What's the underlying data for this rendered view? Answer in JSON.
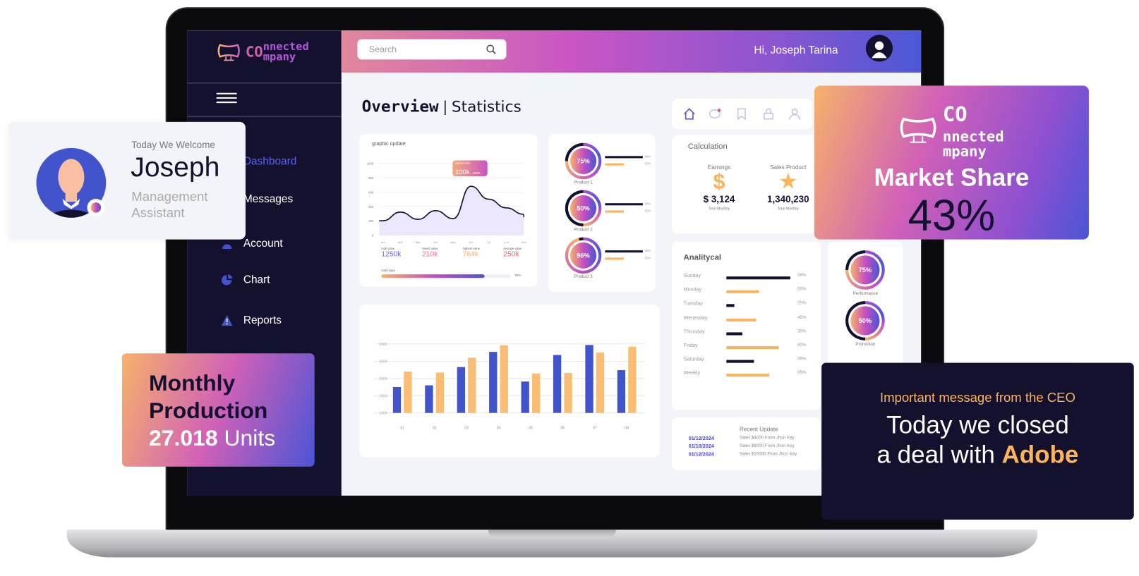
{
  "brand": {
    "line1": "nnected",
    "line2": "mpany",
    "prefix": "CO"
  },
  "sidebar": {
    "items": [
      {
        "label": "Dashboard",
        "icon": "home-icon",
        "active": true
      },
      {
        "label": "Messages",
        "icon": "message-icon"
      },
      {
        "label": "Account",
        "icon": "user-icon"
      },
      {
        "label": "Chart",
        "icon": "pie-chart-icon"
      },
      {
        "label": "Reports",
        "icon": "warning-icon"
      }
    ]
  },
  "header": {
    "search_placeholder": "Search",
    "greeting": "Hi, Joseph Tarina"
  },
  "main": {
    "title": "Overview",
    "subtitle": "Statistics",
    "graphic": {
      "title": "graphic update",
      "y_ticks": [
        "1000",
        "800",
        "600",
        "400",
        "200",
        "0"
      ],
      "months": [
        "Jan",
        "Feb",
        "Mar",
        "Apr",
        "May",
        "Jun",
        "Jul",
        "Aug",
        "Sep"
      ],
      "values": [
        200,
        320,
        220,
        340,
        230,
        680,
        500,
        380,
        290
      ],
      "tooltip": {
        "label": "highest value",
        "value": "100k",
        "change": "250%"
      },
      "stats": [
        {
          "label": "total value",
          "value": "1250k",
          "color": "#7b5be0"
        },
        {
          "label": "lowest value",
          "value": "210k",
          "color": "#e8709a"
        },
        {
          "label": "highest value",
          "value": "764k",
          "color": "#f7b26a"
        },
        {
          "label": "average value",
          "value": "250k",
          "color": "#e86060"
        }
      ],
      "target": {
        "label": "total target",
        "value": "80%",
        "fraction": 0.8
      }
    },
    "products": [
      {
        "name": "Product 1",
        "percent": "75%",
        "p": 75,
        "bar1": "98%",
        "bar2": "50%"
      },
      {
        "name": "Product 2",
        "percent": "50%",
        "p": 50,
        "bar1": "98%",
        "bar2": "50%"
      },
      {
        "name": "Product 3",
        "percent": "96%",
        "p": 96,
        "bar1": "98%",
        "bar2": "50%"
      }
    ],
    "bars": {
      "y_ticks": [
        "3000",
        "2500",
        "2000",
        "1500",
        "1000"
      ],
      "ylim": [
        1000,
        3000
      ],
      "categories": [
        "01",
        "02",
        "03",
        "04",
        "05",
        "06",
        "07",
        "08"
      ],
      "series": [
        {
          "color": "#4254cc",
          "values": [
            1750,
            1800,
            2330,
            2770,
            1910,
            2680,
            2970,
            2240
          ]
        },
        {
          "color": "#fbbd74",
          "values": [
            2200,
            2170,
            2600,
            2960,
            2140,
            2160,
            2750,
            2920
          ]
        }
      ]
    },
    "calculation": {
      "title": "Calculation",
      "earnings": {
        "label": "Earnings",
        "value": "$ 3,124",
        "sub": "Total Monthly"
      },
      "sales": {
        "label": "Sales Product",
        "value": "1,340,230",
        "sub": "Total Monthly"
      }
    },
    "analytical": {
      "title": "Analitycal",
      "rows": [
        {
          "day": "Sunday",
          "pct": 98,
          "label": "98%"
        },
        {
          "day": "Monday",
          "pct": 50,
          "label": "50%"
        },
        {
          "day": "Tuesday",
          "pct": 12,
          "label": "20%"
        },
        {
          "day": "Wenesday",
          "pct": 45,
          "label": "45%"
        },
        {
          "day": "Thrusday",
          "pct": 24,
          "label": "30%"
        },
        {
          "day": "Friday",
          "pct": 80,
          "label": "80%"
        },
        {
          "day": "Saturday",
          "pct": 42,
          "label": "39%"
        },
        {
          "day": "Weekly",
          "pct": 65,
          "label": "65%"
        }
      ]
    },
    "recent": {
      "title": "Recent Update",
      "rows": [
        {
          "date": "01/12/2024",
          "text": "Sales $4000 From Jhon Key"
        },
        {
          "date": "01/10/2024",
          "text": "Sales $8000 From Jhon Key"
        },
        {
          "date": "01/12/2024",
          "text": "Sales $10000 From Jhon Key"
        }
      ]
    },
    "side_donuts": [
      {
        "percent": "75%",
        "p": 75,
        "name": "Performance"
      },
      {
        "percent": "50%",
        "p": 50,
        "name": "Promotion"
      }
    ]
  },
  "welcome": {
    "kicker": "Today We Welcome",
    "name": "Joseph",
    "role1": "Management",
    "role2": "Assistant"
  },
  "market": {
    "title": "Market Share",
    "value": "43%"
  },
  "production": {
    "line1": "Monthly",
    "line2": "Production",
    "value": "27.018",
    "unit": "Units"
  },
  "ceo": {
    "kicker": "Important message from the CEO",
    "line1": "Today we closed",
    "line2": "a deal with",
    "company": "Adobe"
  }
}
